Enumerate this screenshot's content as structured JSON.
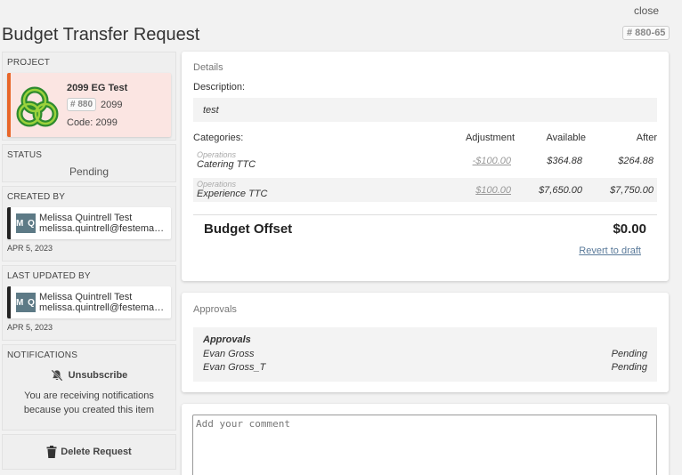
{
  "window": {
    "close_label": "close"
  },
  "header": {
    "title": "Budget Transfer Request",
    "ref": "# 880-65"
  },
  "sidebar": {
    "project": {
      "label": "PROJECT",
      "name": "2099 EG Test",
      "number_badge": "# 880",
      "number": "2099",
      "code": "Code: 2099",
      "accent_color": "#e8672a"
    },
    "status": {
      "label": "STATUS",
      "value": "Pending"
    },
    "created_by": {
      "label": "CREATED BY",
      "initials": "M Q",
      "name": "Melissa Quintrell Test",
      "email": "melissa.quintrell@festemamanagement.com",
      "date": "APR 5, 2023"
    },
    "last_updated_by": {
      "label": "LAST UPDATED BY",
      "initials": "M Q",
      "name": "Melissa Quintrell Test",
      "email": "melissa.quintrell@festemamanagement.com",
      "date": "APR 5, 2023"
    },
    "notifications": {
      "label": "NOTIFICATIONS",
      "unsubscribe_label": "Unsubscribe",
      "unsubscribe_icon": "bell-off-icon",
      "message": "You are receiving notifications because you created this item"
    },
    "delete": {
      "label": "Delete Request",
      "icon": "trash-icon"
    }
  },
  "details": {
    "heading": "Details",
    "description_label": "Description:",
    "description_value": "test",
    "categories_label": "Categories:",
    "columns": {
      "adjustment": "Adjustment",
      "available": "Available",
      "after": "After"
    },
    "rows": [
      {
        "group": "Operations",
        "name": "Catering TTC",
        "adjustment": "-$100.00",
        "available": "$364.88",
        "after": "$264.88"
      },
      {
        "group": "Operations",
        "name": "Experience TTC",
        "adjustment": "$100.00",
        "available": "$7,650.00",
        "after": "$7,750.00"
      }
    ],
    "offset_label": "Budget Offset",
    "offset_value": "$0.00",
    "revert_label": "Revert to draft"
  },
  "approvals": {
    "heading": "Approvals",
    "title": "Approvals",
    "rows": [
      {
        "name": "Evan Gross",
        "status": "Pending"
      },
      {
        "name": "Evan Gross_T",
        "status": "Pending"
      }
    ]
  },
  "comment": {
    "placeholder": "Add your comment"
  }
}
